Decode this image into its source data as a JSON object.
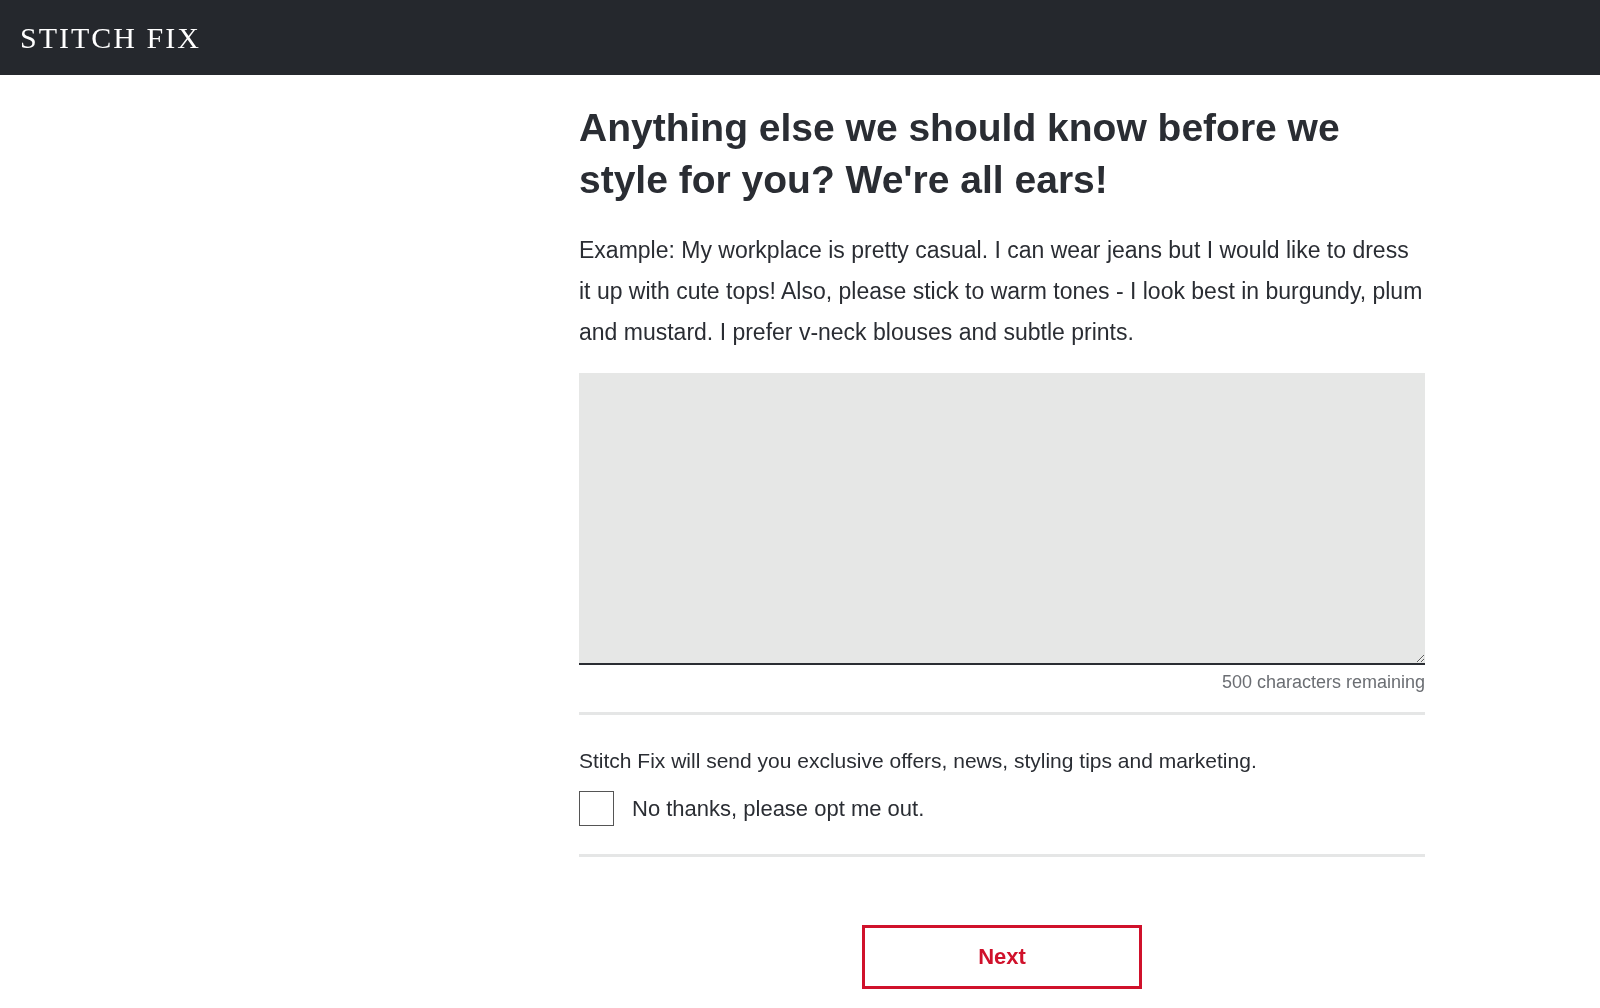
{
  "header": {
    "logo": "STITCH FIX"
  },
  "question": {
    "title": "Anything else we should know before we style for you? We're all ears!",
    "example": "Example: My workplace is pretty casual. I can wear jeans but I would like to dress it up with cute tops! Also, please stick to warm tones - I look best in burgundy, plum and mustard. I prefer v-neck blouses and subtle prints.",
    "counter": "500 characters remaining"
  },
  "marketing": {
    "notice": "Stitch Fix will send you exclusive offers, news, styling tips and marketing.",
    "opt_out": {
      "label": "No thanks, please opt me out.",
      "checked": false
    }
  },
  "buttons": [
    {
      "label": "Next"
    }
  ]
}
